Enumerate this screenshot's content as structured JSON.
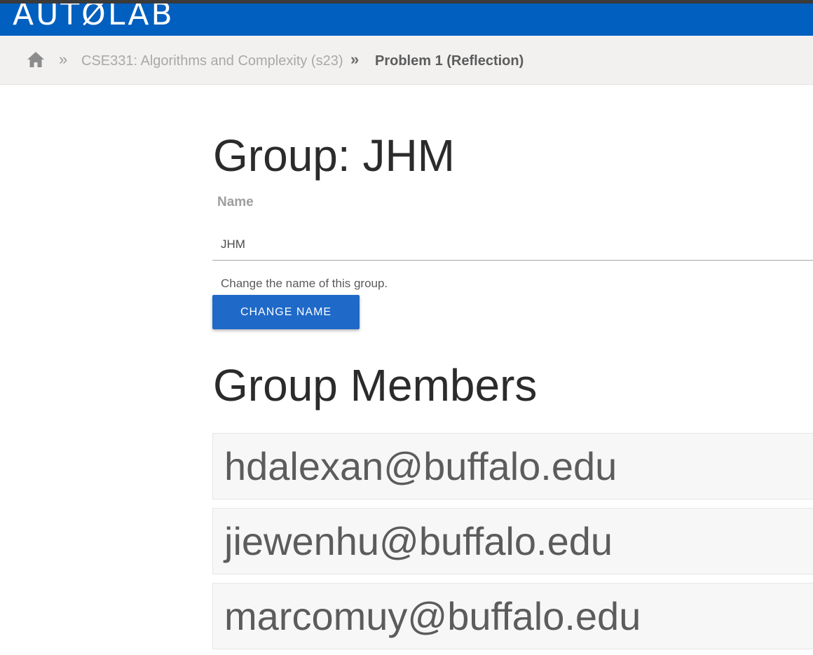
{
  "navbar": {
    "logo_text": "AUTØLAB",
    "color": "#005fbf"
  },
  "breadcrumb": {
    "home_icon": "home-icon",
    "separator": "»",
    "course": "CSE331: Algorithms and Complexity (s23)",
    "current": "Problem 1 (Reflection)"
  },
  "group": {
    "title": "Group: JHM",
    "name_label": "Name",
    "name_value": "JHM",
    "help_text": "Change the name of this group.",
    "change_button": "Change Name"
  },
  "members": {
    "title": "Group Members",
    "items": [
      "hdalexan@buffalo.edu",
      "jiewenhu@buffalo.edu",
      "marcomuy@buffalo.edu"
    ]
  },
  "colors": {
    "primary": "#005fbf",
    "button": "#1f69c8",
    "breadcrumb_bg": "#f2f1f0",
    "member_bg": "#f7f7f7"
  }
}
